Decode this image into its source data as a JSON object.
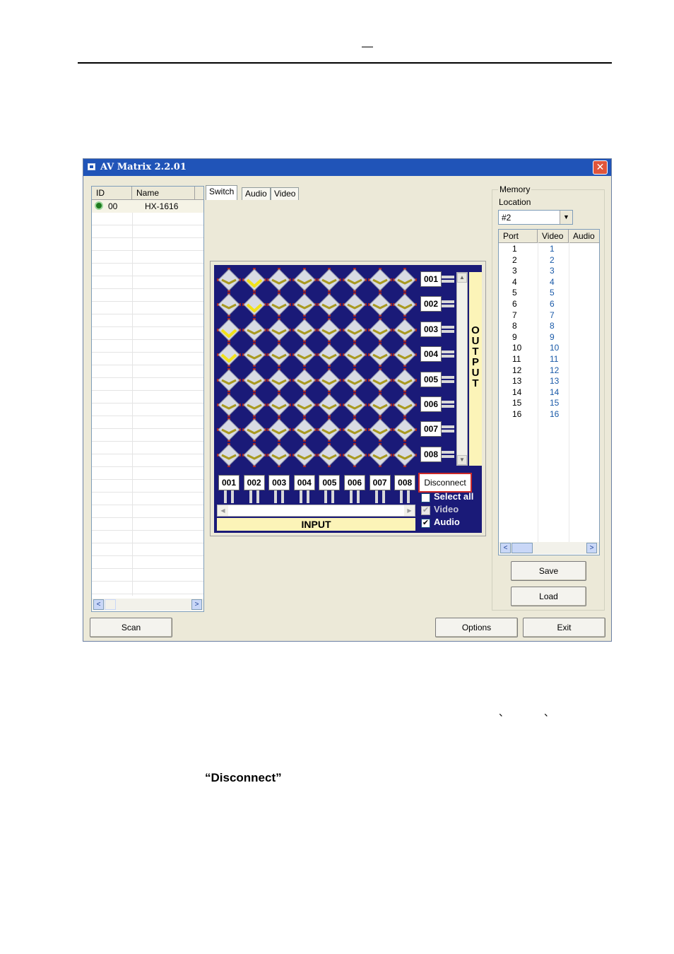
{
  "window": {
    "title": "AV Matrix 2.2.01",
    "close_glyph": "✕"
  },
  "device_list": {
    "columns": [
      "ID",
      "Name"
    ],
    "rows": [
      {
        "id": "00",
        "name": "HX-1616",
        "status_color": "#1e7a1e"
      }
    ]
  },
  "tabs": [
    {
      "label": "Switch",
      "active": true
    },
    {
      "label": "Audio"
    },
    {
      "label": "Video"
    }
  ],
  "matrix": {
    "outputs": [
      "001",
      "002",
      "003",
      "004",
      "005",
      "006",
      "007",
      "008"
    ],
    "inputs": [
      "001",
      "002",
      "003",
      "004",
      "005",
      "006",
      "007",
      "008"
    ],
    "connections": [
      [
        0,
        1
      ],
      [
        1,
        1
      ],
      [
        2,
        0
      ],
      [
        3,
        0
      ]
    ],
    "output_label": [
      "O",
      "U",
      "T",
      "P",
      "U",
      "T"
    ],
    "input_label": "INPUT",
    "disconnect_label": "Disconnect",
    "select_all_label": "Select all",
    "video_label": "Video",
    "audio_label": "Audio",
    "select_all_checked": false,
    "video_checked": true,
    "audio_checked": true
  },
  "memory": {
    "group_label": "Memory",
    "location_label": "Location",
    "location_value": "#2",
    "columns": [
      "Port",
      "Video",
      "Audio"
    ],
    "rows": [
      {
        "port": "1",
        "video": "1"
      },
      {
        "port": "2",
        "video": "2"
      },
      {
        "port": "3",
        "video": "3"
      },
      {
        "port": "4",
        "video": "4"
      },
      {
        "port": "5",
        "video": "5"
      },
      {
        "port": "6",
        "video": "6"
      },
      {
        "port": "7",
        "video": "7"
      },
      {
        "port": "8",
        "video": "8"
      },
      {
        "port": "9",
        "video": "9"
      },
      {
        "port": "10",
        "video": "10"
      },
      {
        "port": "11",
        "video": "11"
      },
      {
        "port": "12",
        "video": "12"
      },
      {
        "port": "13",
        "video": "13"
      },
      {
        "port": "14",
        "video": "14"
      },
      {
        "port": "15",
        "video": "15"
      },
      {
        "port": "16",
        "video": "16"
      }
    ],
    "save_label": "Save",
    "load_label": "Load"
  },
  "buttons": {
    "scan": "Scan",
    "options": "Options",
    "exit": "Exit"
  },
  "doc": {
    "quote": "“Disconnect”",
    "header_mark": "—",
    "tick_1": "、",
    "tick_2": "、"
  }
}
